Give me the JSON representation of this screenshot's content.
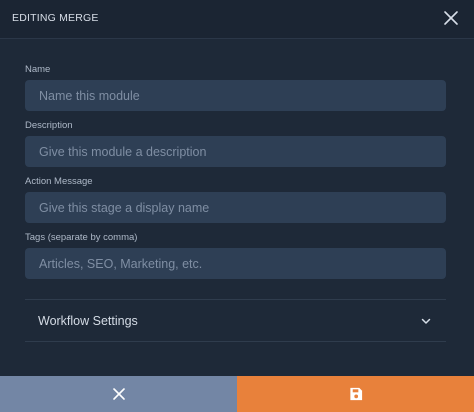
{
  "header": {
    "title": "EDITING MERGE",
    "close_icon": "close-icon"
  },
  "form": {
    "name": {
      "label": "Name",
      "placeholder": "Name this module",
      "value": ""
    },
    "description": {
      "label": "Description",
      "placeholder": "Give this module a description",
      "value": ""
    },
    "action_message": {
      "label": "Action Message",
      "placeholder": "Give this stage a display name",
      "value": ""
    },
    "tags": {
      "label": "Tags (separate by comma)",
      "placeholder": "Articles, SEO, Marketing, etc.",
      "value": ""
    }
  },
  "workflow_settings": {
    "label": "Workflow Settings",
    "icon": "chevron-down-icon"
  },
  "footer": {
    "cancel_icon": "close-icon",
    "save_icon": "save-icon"
  },
  "colors": {
    "background": "#1e2938",
    "input_bg": "#2e3f55",
    "cancel_bg": "#7386a5",
    "save_bg": "#e8813b"
  }
}
